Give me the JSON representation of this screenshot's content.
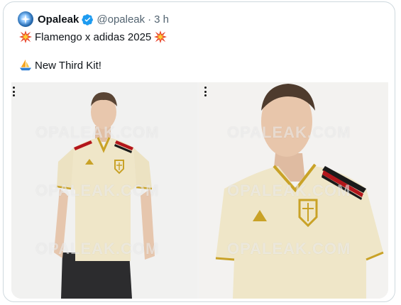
{
  "tweet": {
    "author_name": "Opaleak",
    "author_handle": "@opaleak",
    "separator": "·",
    "time": "3 h",
    "line1_text": "Flamengo x adidas 2025",
    "line2_text": "New Third Kit!",
    "emoji_line1": "collision-icon",
    "emoji_line2": "sailboat-icon",
    "watermark": "OPALEAK.COM"
  },
  "colors": {
    "verified": "#1d9bf0",
    "text": "#0f1419",
    "muted": "#536471",
    "border": "#cfd9de",
    "kit": "#efe6c8",
    "kit_trim": "#c9a227",
    "stripe_red": "#b3161b",
    "stripe_black": "#1a1a1a"
  }
}
